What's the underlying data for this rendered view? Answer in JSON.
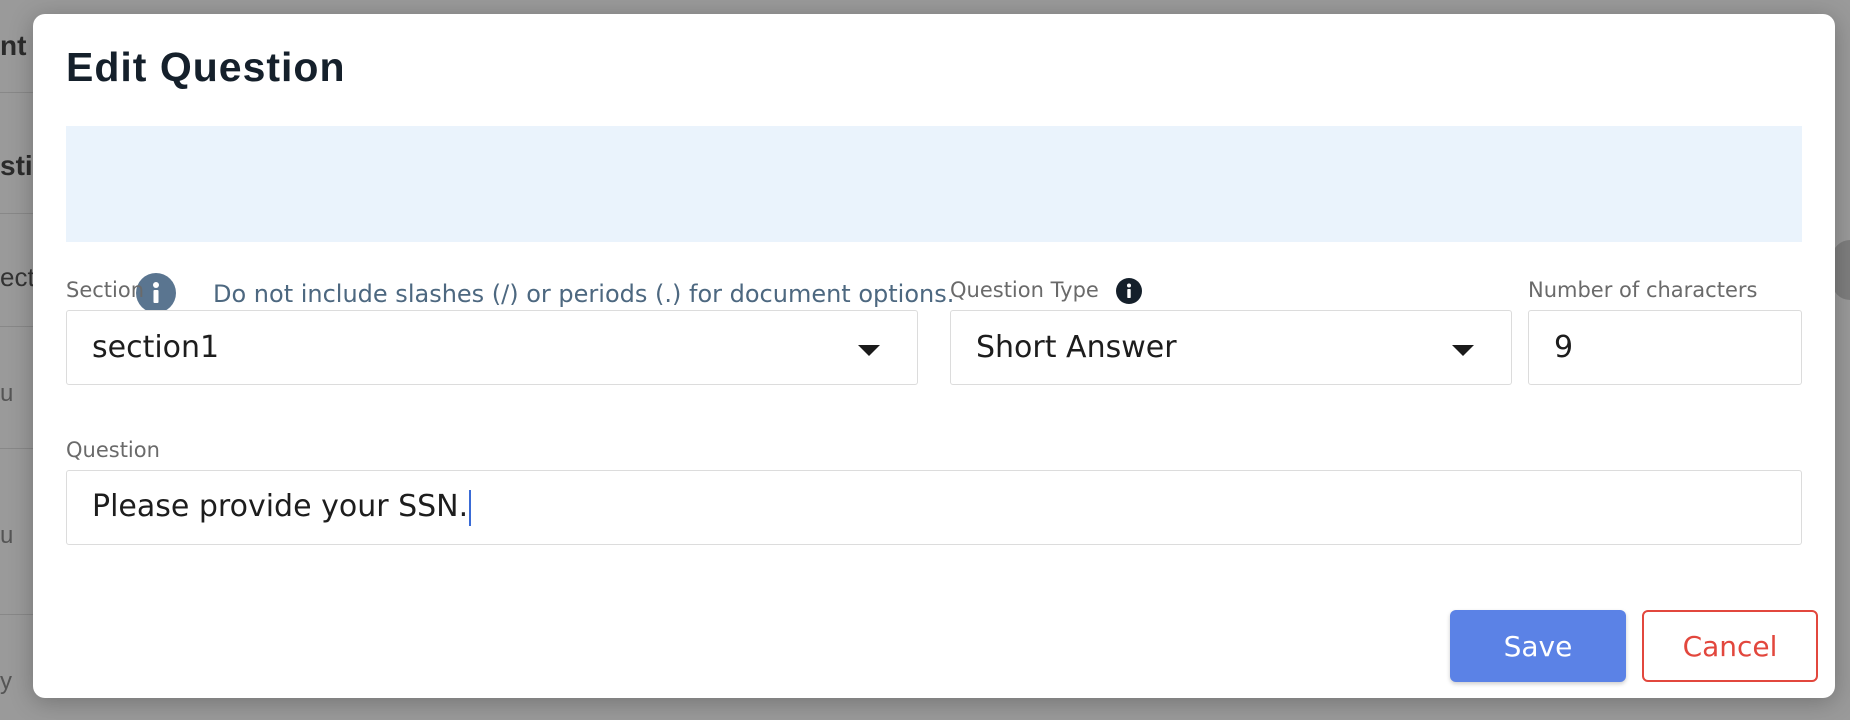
{
  "background_page": {
    "title_fragment": "nt L",
    "subtitle_fragment": "sti",
    "section_fragment": "ecti",
    "row_fragments": [
      "u",
      "u",
      "y"
    ]
  },
  "modal": {
    "title": "Edit Question",
    "info_banner": {
      "icon": "info-icon",
      "text": "Do not include slashes (/) or periods (.) for document options."
    },
    "section": {
      "label": "Section",
      "value": "section1",
      "icon": "caret-down-icon"
    },
    "question_type": {
      "label": "Question Type",
      "value": "Short Answer",
      "info_icon": "info-icon",
      "icon": "caret-down-icon"
    },
    "number_of_characters": {
      "label": "Number of characters",
      "value": "9"
    },
    "question": {
      "label": "Question",
      "value": "Please provide your SSN."
    },
    "buttons": {
      "save_label": "Save",
      "cancel_label": "Cancel"
    },
    "colors": {
      "save_bg": "#5b82e6",
      "cancel_accent": "#e2473d",
      "banner_bg": "#eaf3fc"
    }
  }
}
